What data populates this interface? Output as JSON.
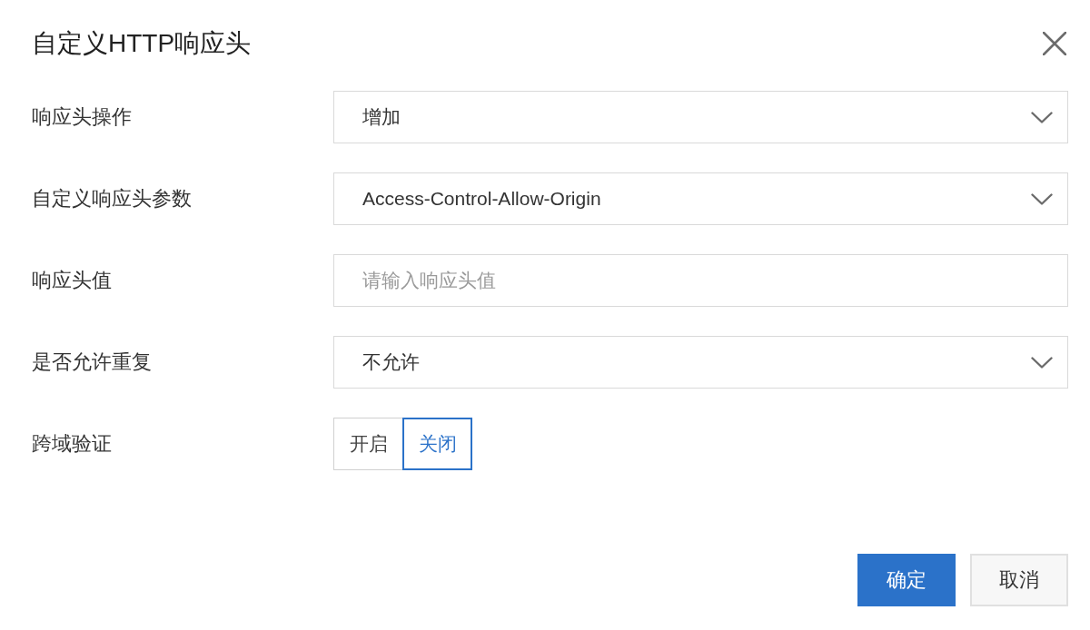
{
  "dialog": {
    "title": "自定义HTTP响应头"
  },
  "fields": [
    {
      "kind": "select",
      "label": "响应头操作",
      "value": "增加"
    },
    {
      "kind": "select",
      "label": "自定义响应头参数",
      "value": "Access-Control-Allow-Origin"
    },
    {
      "kind": "input",
      "label": "响应头值",
      "placeholder": "请输入响应头值"
    },
    {
      "kind": "select",
      "label": "是否允许重复",
      "value": "不允许"
    },
    {
      "kind": "toggle",
      "label": "跨域验证",
      "options": [
        {
          "label": "开启",
          "selected": false
        },
        {
          "label": "关闭",
          "selected": true
        }
      ]
    }
  ],
  "buttons": [
    {
      "label": "确定",
      "kind": "primary"
    },
    {
      "label": "取消",
      "kind": "secondary"
    }
  ]
}
